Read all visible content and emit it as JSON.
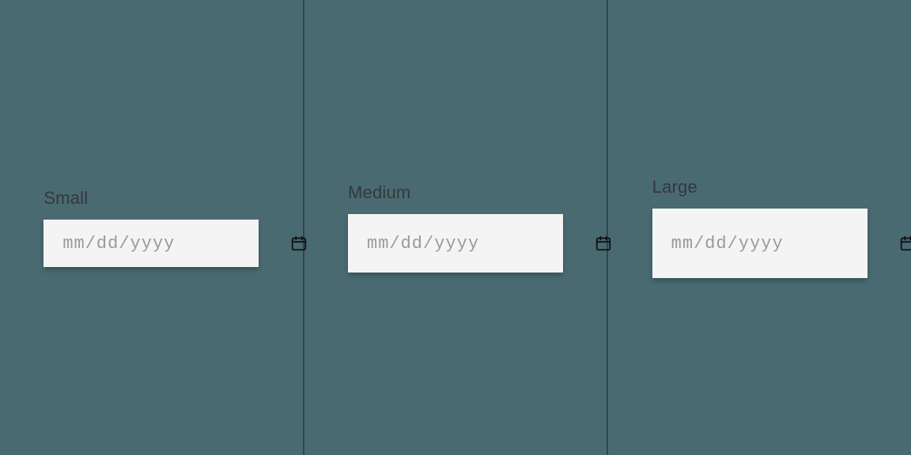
{
  "variants": [
    {
      "key": "small",
      "label": "Small",
      "placeholder": "mm/dd/yyyy",
      "size": "sm"
    },
    {
      "key": "medium",
      "label": "Medium",
      "placeholder": "mm/dd/yyyy",
      "size": "md"
    },
    {
      "key": "large",
      "label": "Large",
      "placeholder": "mm/dd/yyyy",
      "size": "lg"
    }
  ]
}
